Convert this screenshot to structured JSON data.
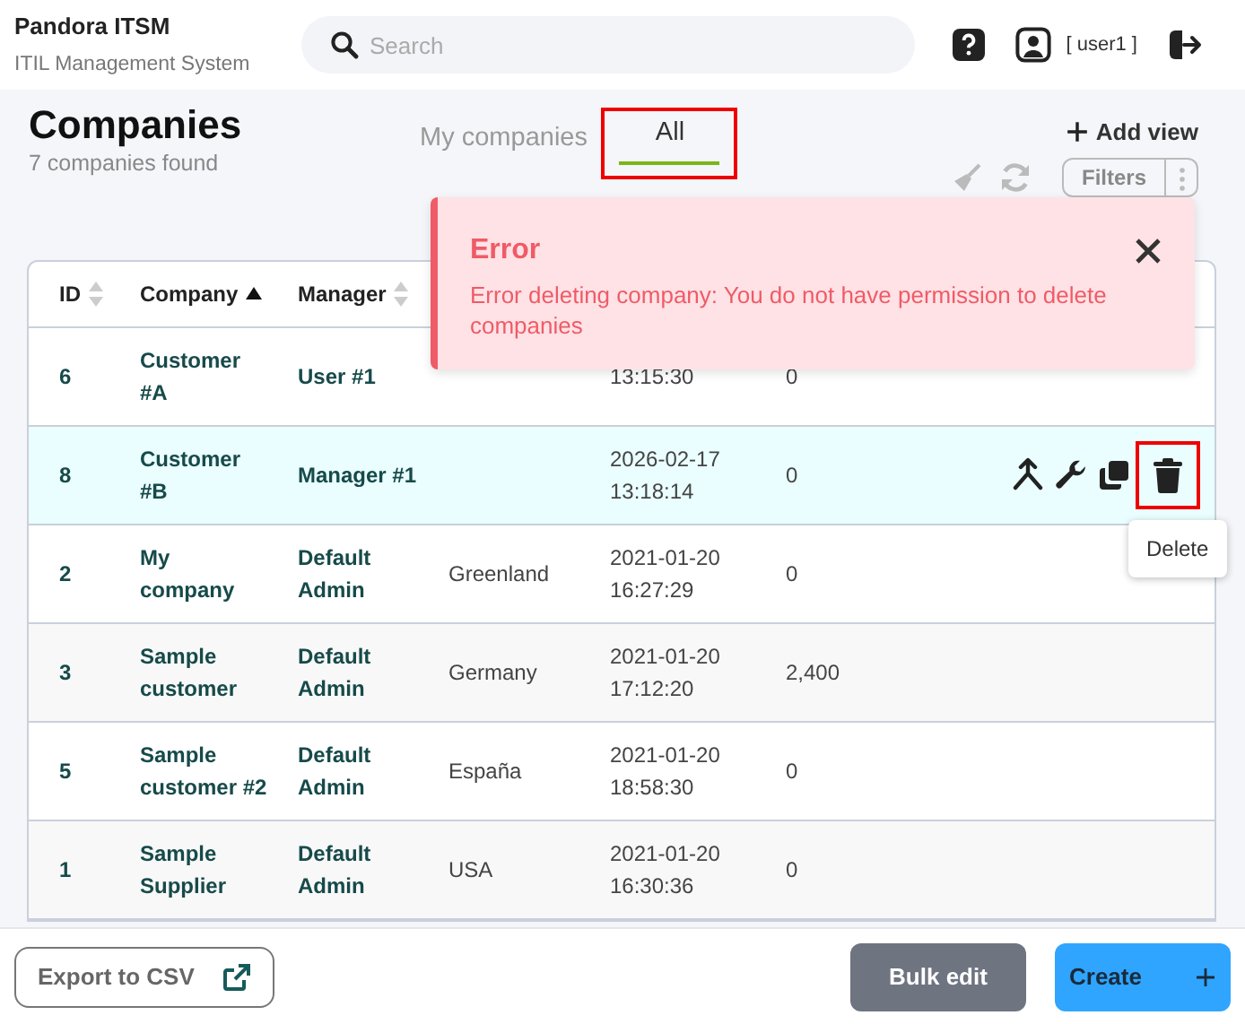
{
  "app": {
    "title": "Pandora ITSM",
    "subtitle": "ITIL Management System"
  },
  "search": {
    "placeholder": "Search"
  },
  "user": {
    "name": "[ user1 ]"
  },
  "page": {
    "title": "Companies",
    "count": "7 companies found"
  },
  "tabs": [
    {
      "label": "My companies",
      "selected": false,
      "highlighted": false
    },
    {
      "label": "All",
      "selected": true,
      "highlighted": true
    }
  ],
  "add_view": "Add view",
  "filters_button": "Filters",
  "table": {
    "columns": [
      {
        "label": "ID",
        "sorted": false
      },
      {
        "label": "Company",
        "sorted": true
      },
      {
        "label": "Manager",
        "sorted": false
      }
    ],
    "rows": [
      {
        "cells": [
          "6",
          "Customer #A",
          "User #1",
          "",
          "13:15:30",
          "0"
        ],
        "hovered": false
      },
      {
        "cells": [
          "8",
          "Customer #B",
          "Manager #1",
          "",
          "2026-02-17 13:18:14",
          "0"
        ],
        "hovered": true,
        "actions": [
          {
            "kind": "fork"
          },
          {
            "kind": "wrench"
          },
          {
            "kind": "copy"
          },
          {
            "kind": "trash",
            "highlighted": true,
            "tooltip": "Delete"
          }
        ]
      },
      {
        "cells": [
          "2",
          "My company",
          "Default Admin",
          "Greenland",
          "2021-01-20 16:27:29",
          "0"
        ],
        "hovered": false
      },
      {
        "cells": [
          "3",
          "Sample customer",
          "Default Admin",
          "Germany",
          "2021-01-20 17:12:20",
          "2,400"
        ],
        "hovered": false
      },
      {
        "cells": [
          "5",
          "Sample customer #2",
          "Default Admin",
          "España",
          "2021-01-20 18:58:30",
          "0"
        ],
        "hovered": false
      },
      {
        "cells": [
          "1",
          "Sample Supplier",
          "Default Admin",
          "USA",
          "2021-01-20 16:30:36",
          "0"
        ],
        "hovered": false
      }
    ]
  },
  "error": {
    "title": "Error",
    "message": "Error deleting company: You do not have permission to delete companies"
  },
  "footer": {
    "export": "Export to CSV",
    "bulk_edit": "Bulk edit",
    "create": "Create"
  }
}
